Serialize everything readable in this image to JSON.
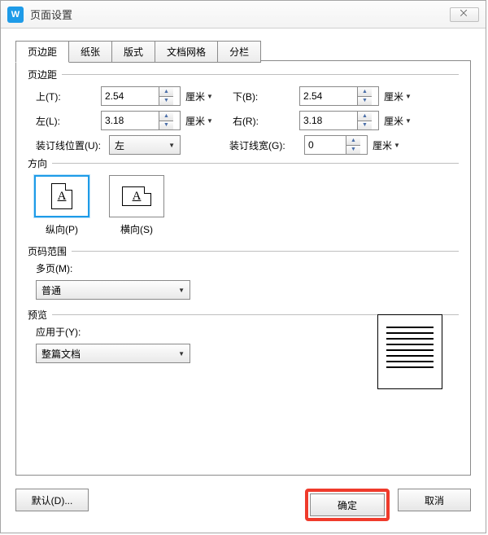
{
  "window": {
    "title": "页面设置",
    "app_icon_text": "W",
    "close_glyph": "⨉"
  },
  "tabs": {
    "margins": "页边距",
    "paper": "纸张",
    "layout": "版式",
    "grid": "文档网格",
    "columns": "分栏"
  },
  "margins": {
    "legend": "页边距",
    "top_label": "上(T):",
    "top_value": "2.54",
    "bottom_label": "下(B):",
    "bottom_value": "2.54",
    "left_label": "左(L):",
    "left_value": "3.18",
    "right_label": "右(R):",
    "right_value": "3.18",
    "gutter_pos_label": "装订线位置(U):",
    "gutter_pos_value": "左",
    "gutter_width_label": "装订线宽(G):",
    "gutter_width_value": "0",
    "unit": "厘米"
  },
  "orientation": {
    "legend": "方向",
    "portrait": "纵向(P)",
    "landscape": "横向(S)",
    "glyph": "A"
  },
  "pages": {
    "legend": "页码范围",
    "multi_label": "多页(M):",
    "multi_value": "普通"
  },
  "preview": {
    "legend": "预览",
    "apply_label": "应用于(Y):",
    "apply_value": "整篇文档"
  },
  "footer": {
    "default": "默认(D)...",
    "ok": "确定",
    "cancel": "取消"
  }
}
